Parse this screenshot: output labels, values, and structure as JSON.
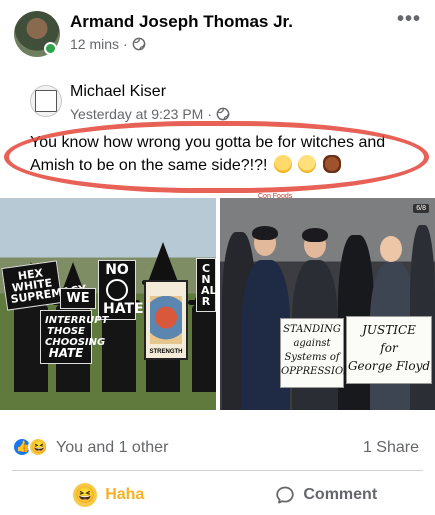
{
  "post": {
    "author": "Armand Joseph Thomas Jr.",
    "time": "12 mins",
    "separator": "·",
    "privacy_icon": "globe-icon",
    "more_icon": "more-options-icon"
  },
  "shared": {
    "author": "Michael Kiser",
    "time": "Yesterday at 9:23 PM",
    "separator": "·",
    "text": "You know how wrong you gotta be for witches and Amish to be on the same side?!?!",
    "emojis": [
      "laughing-emoji",
      "crying-laughing-emoji",
      "raised-fist-emoji"
    ],
    "source_label": "Con Foods"
  },
  "photo_left": {
    "signs": [
      "HEX",
      "WHITE",
      "SUPREMACY",
      "WE",
      "NO",
      "HATE",
      "INTERRUPT",
      "THOSE",
      "CHOOSING",
      "HATE",
      "C",
      "N",
      "AL",
      "R"
    ],
    "card_label": "STRENGTH"
  },
  "photo_right": {
    "sign_left": [
      "STANDING",
      "against",
      "Systems of",
      "OPPRESSION"
    ],
    "sign_right": [
      "JUSTICE",
      "for",
      "George Floyd"
    ],
    "badge": "6/8"
  },
  "reactions": {
    "summary": "You and 1 other",
    "shares": "1 Share"
  },
  "actions": {
    "haha_label": "Haha",
    "comment_label": "Comment"
  },
  "colors": {
    "brand_blue": "#1877f2",
    "haha_yellow": "#f7b125",
    "meta_gray": "#65676b",
    "annotation_red": "#e4453a",
    "online_green": "#31a24c"
  }
}
